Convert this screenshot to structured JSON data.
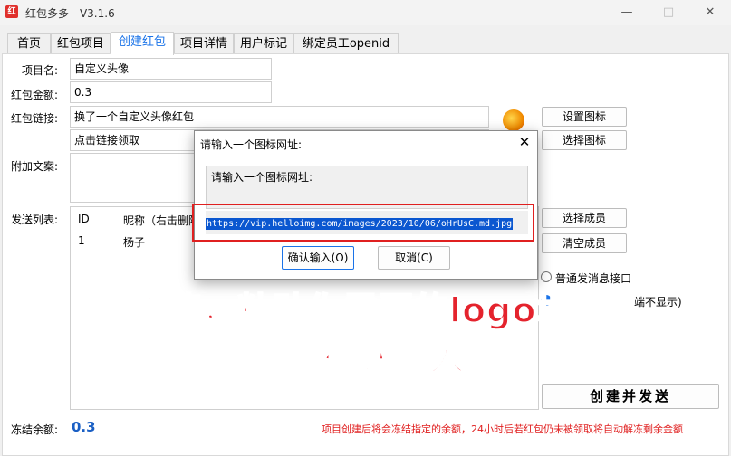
{
  "window": {
    "title": "红包多多 - V3.1.6",
    "app_icon_glyph": "红"
  },
  "tabs": [
    {
      "label": "首页"
    },
    {
      "label": "红包项目"
    },
    {
      "label": "创建红包"
    },
    {
      "label": "项目详情"
    },
    {
      "label": "用户标记"
    },
    {
      "label": "绑定员工openid"
    }
  ],
  "form": {
    "project_name_label": "项目名:",
    "project_name_value": "自定义头像",
    "amount_label": "红包金额:",
    "amount_value": "0.3",
    "link_label": "红包链接:",
    "link_title_value": "换了一个自定义头像红包",
    "link_desc_value": "点击链接领取",
    "extra_label": "附加文案:",
    "send_list_label": "发送列表:",
    "frozen_label": "冻结余额:",
    "frozen_value": "0.3",
    "notice": "项目创建后将会冻结指定的余额，24小时后若红包仍未被领取将自动解冻剩余金额"
  },
  "buttons": {
    "set_icon": "设置图标",
    "choose_icon": "选择图标",
    "choose_member": "选择成员",
    "clear_member": "清空成员",
    "create_send": "创建并发送"
  },
  "member_list": {
    "columns": [
      "ID",
      "昵称（右击删除"
    ],
    "rows": [
      {
        "id": "1",
        "name": "杨子"
      }
    ]
  },
  "radio": {
    "option1": "普通发消息接口",
    "option2_tail": "端不显示)"
  },
  "dialog": {
    "title": "请输入一个图标网址:",
    "prompt": "请输入一个图标网址:",
    "input_value": "https://vip.helloimg.com/images/2023/10/06/oHrUsC.md.jpg",
    "ok": "确认输入(O)",
    "cancel": "取消(C)"
  },
  "overlay": {
    "line1": "清空掉，粘贴你需要的logo地址",
    "line2": "点确认输入"
  },
  "colors": {
    "accent": "#1a73e8",
    "overlay_red": "#e4232d",
    "notice_red": "#e02020"
  }
}
